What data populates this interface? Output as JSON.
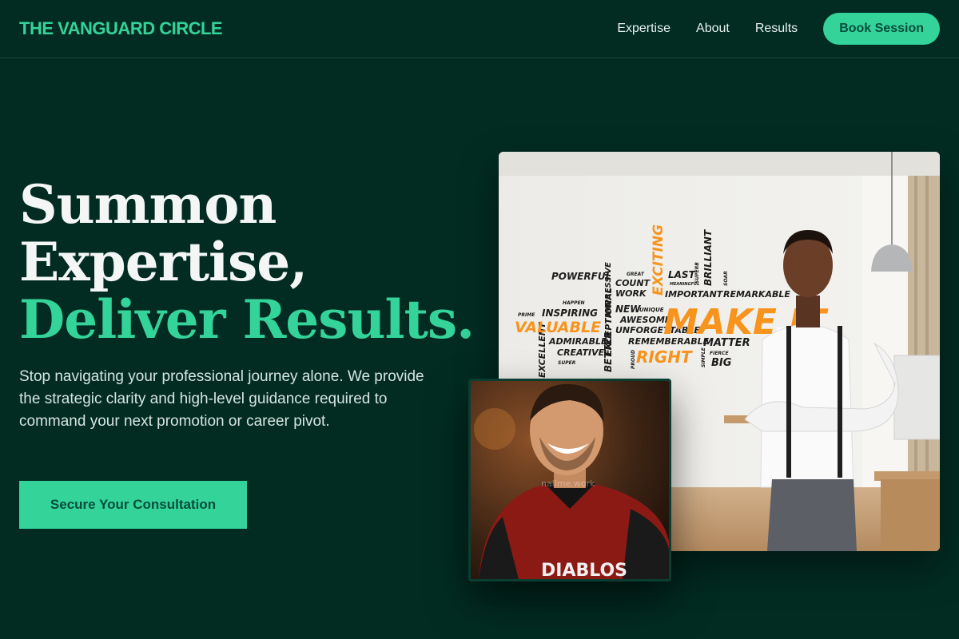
{
  "nav": {
    "brand": "THE VANGUARD CIRCLE",
    "links": [
      "Expertise",
      "About",
      "Results"
    ],
    "cta": "Book Session"
  },
  "hero": {
    "line1": "Summon",
    "line2": "Expertise,",
    "line3": "Deliver Results.",
    "subtitle": "Stop navigating your professional journey alone. We provide the strategic clarity and high-level guidance required to command your next promotion or career pivot.",
    "cta": "Secure Your Consultation"
  },
  "images": {
    "office": {
      "description_icon": "office-photo",
      "wall_words": [
        "POWERFUL",
        "GREAT",
        "COUNT",
        "WORK",
        "EXCITING",
        "LAST",
        "MEANINGFUL",
        "SUPERB",
        "BRILLIANT",
        "SOAR",
        "IMPORTANT",
        "REMARKABLE",
        "HAPPEN",
        "IMPRESSIVE",
        "EXCEPTIONAL",
        "PRIME",
        "INSPIRING",
        "NEW",
        "UNIQUE",
        "AWESOME",
        "MAKE IT",
        "VALUABLE",
        "UNFORGETTABLE",
        "ADMIRABLE",
        "BETTER",
        "REMEMBERABLE",
        "MATTER",
        "EXCELLENT",
        "CREATIVE",
        "PROUD",
        "RIGHT",
        "SIMPLE",
        "FIERCE",
        "BIG",
        "SUPER"
      ]
    },
    "portrait": {
      "description_icon": "portrait-photo",
      "shirt_text": "DIABLOS",
      "watermark": "nailme.work"
    }
  },
  "colors": {
    "background": "#022c22",
    "accent": "#34d399",
    "accent_dark_text": "#064e3b",
    "orange": "#f7941d"
  }
}
